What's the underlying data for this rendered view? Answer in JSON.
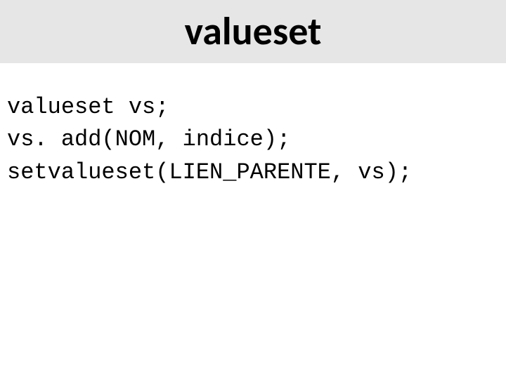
{
  "title": "valueset",
  "code": {
    "line1": "valueset vs;",
    "line2": "vs. add(NOM, indice);",
    "line3": "setvalueset(LIEN_PARENTE, vs);"
  }
}
